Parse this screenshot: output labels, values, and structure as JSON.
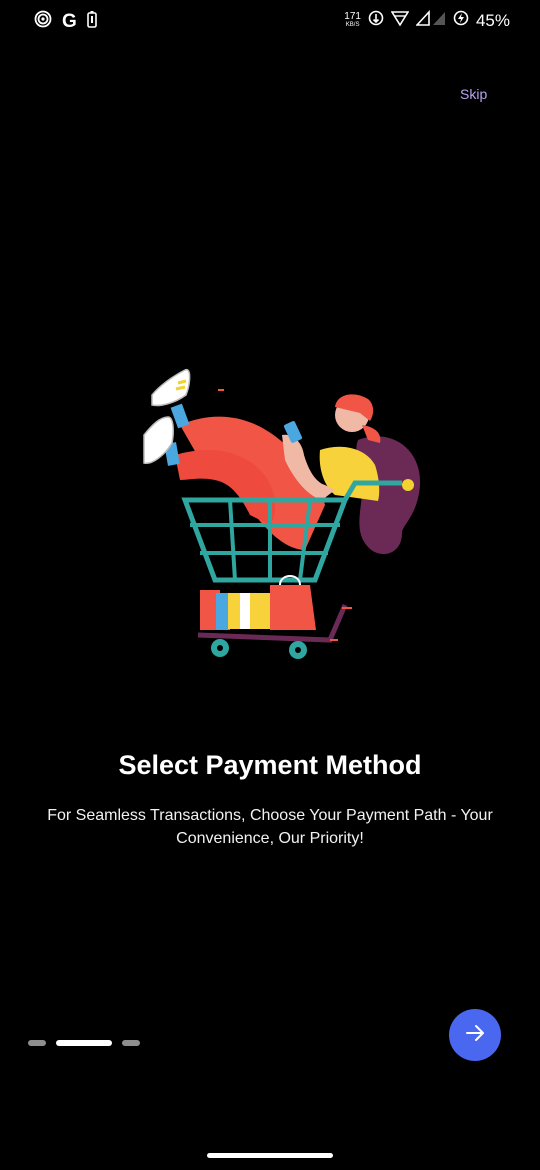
{
  "status_bar": {
    "net_speed": "171",
    "net_speed_unit": "KB/S",
    "battery_percent": "45%",
    "g_label": "G",
    "icons": [
      "alarm-icon",
      "google-icon",
      "battery-saver-icon",
      "data-saver-icon",
      "wifi-icon",
      "signal-icon",
      "battery-icon"
    ]
  },
  "header": {
    "skip_label": "Skip"
  },
  "onboarding": {
    "title": "Select Payment Method",
    "description": "For Seamless Transactions, Choose Your Payment Path - Your Convenience, Our Priority!",
    "illustration": "woman-in-shopping-cart-illustration",
    "page_count": 3,
    "active_page": 2
  },
  "next_button": {
    "icon": "arrow-right-icon"
  },
  "colors": {
    "background": "#000000",
    "accent": "#4a67f0",
    "skip": "#b9a3f0",
    "dot_inactive": "#8e8e8e",
    "dot_active": "#ffffff"
  }
}
